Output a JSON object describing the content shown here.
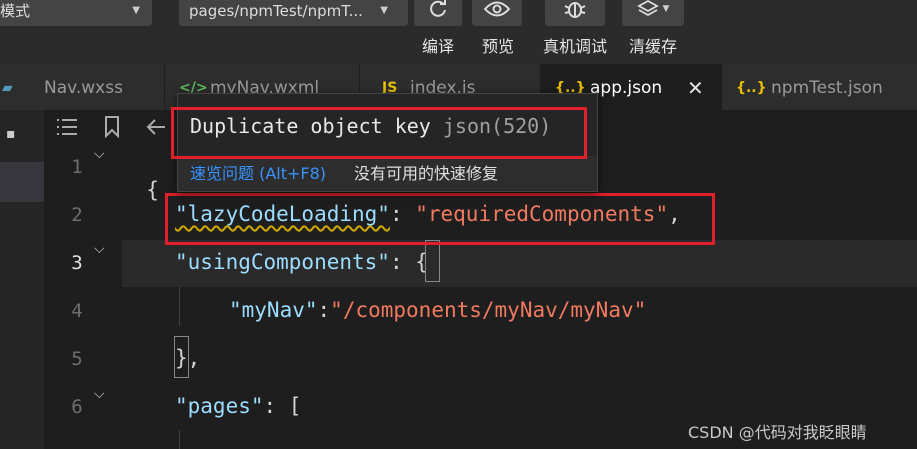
{
  "toolbar": {
    "mode_dropdown": "模式",
    "page_dropdown": "pages/npmTest/npmT...",
    "buttons": [
      {
        "label": "编译",
        "icon": "refresh-icon"
      },
      {
        "label": "预览",
        "icon": "eye-icon"
      },
      {
        "label": "真机调试",
        "icon": "bug-icon"
      },
      {
        "label": "清缓存",
        "icon": "layers-icon"
      }
    ]
  },
  "tabs": [
    {
      "label": "Nav.wxss",
      "icon": "css-file-icon"
    },
    {
      "label": "myNav.wxml",
      "icon": "wxml-file-icon"
    },
    {
      "label": "index.js",
      "icon": "js-file-icon",
      "icon_text": "JS"
    },
    {
      "label": "app.json",
      "icon": "json-file-icon",
      "icon_text": "{..}",
      "active": true,
      "close": "✕"
    },
    {
      "label": "npmTest.json",
      "icon": "json-file-icon",
      "icon_text": "{..}"
    }
  ],
  "gutter": {
    "line_numbers": [
      "1",
      "2",
      "3",
      "4",
      "5",
      "6"
    ]
  },
  "code": {
    "l1": "{",
    "l2_key": "\"lazyCodeLoading\"",
    "l2_sep": ": ",
    "l2_val": "\"requiredComponents\"",
    "l2_end": ",",
    "l3_key": "\"usingComponents\"",
    "l3_sep": ": ",
    "l3_brace": "{",
    "l4_key": "\"myNav\"",
    "l4_sep": ":",
    "l4_val": "\"/components/myNav/myNav\"",
    "l5": "},",
    "l6_key": "\"pages\"",
    "l6_sep": ": ["
  },
  "hover": {
    "message": "Duplicate object key",
    "code": "json(520)",
    "peek_problem": "速览问题",
    "peek_shortcut": "(Alt+F8)",
    "no_quick_fix": "没有可用的快速修复"
  },
  "watermark": "CSDN @代码对我眨眼睛",
  "colors": {
    "highlight_box": "#e0202a",
    "string": "#f07a5f",
    "key": "#9cdcfe",
    "link": "#3794ff",
    "warning_squiggle": "#cca700"
  }
}
